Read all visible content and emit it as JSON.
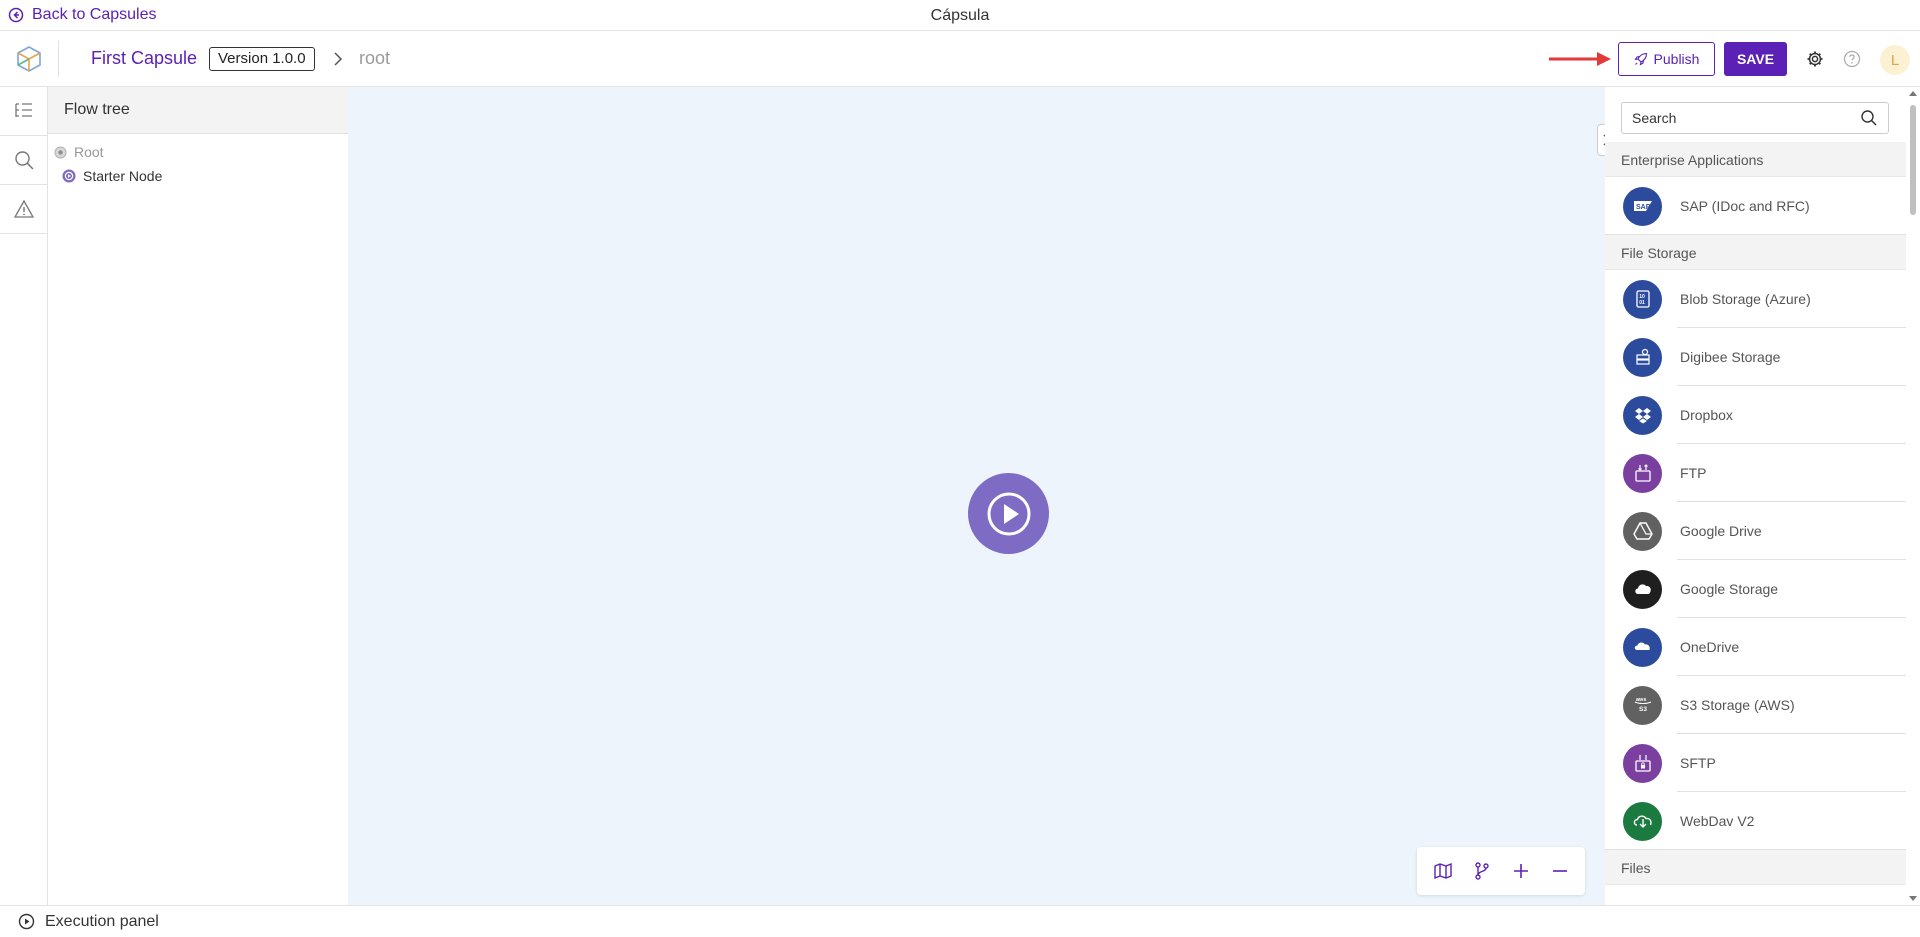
{
  "topbar": {
    "back_label": "Back to Capsules",
    "window_title": "Cápsula"
  },
  "header": {
    "capsule_name": "First Capsule",
    "version": "Version 1.0.0",
    "crumb": "root",
    "publish_label": "Publish",
    "save_label": "SAVE",
    "avatar_initial": "L"
  },
  "colors": {
    "accent": "#5b21b6",
    "node": "#7e6bc4",
    "canvas": "#eef4fc"
  },
  "flow_tree": {
    "title": "Flow tree",
    "root_label": "Root",
    "starter_label": "Starter Node"
  },
  "search": {
    "placeholder": "Search"
  },
  "groups": [
    {
      "title": "Enterprise Applications",
      "items": [
        {
          "label": "SAP (IDoc and RFC)",
          "icon": "sap-icon",
          "color": "#2d4b9c"
        }
      ]
    },
    {
      "title": "File Storage",
      "items": [
        {
          "label": "Blob Storage (Azure)",
          "icon": "blob-storage-icon",
          "color": "#2d4b9c"
        },
        {
          "label": "Digibee Storage",
          "icon": "digibee-storage-icon",
          "color": "#2d4b9c"
        },
        {
          "label": "Dropbox",
          "icon": "dropbox-icon",
          "color": "#2d4b9c"
        },
        {
          "label": "FTP",
          "icon": "ftp-icon",
          "color": "#7b3fa0"
        },
        {
          "label": "Google Drive",
          "icon": "google-drive-icon",
          "color": "#616161"
        },
        {
          "label": "Google Storage",
          "icon": "google-storage-icon",
          "color": "#1f1f1f"
        },
        {
          "label": "OneDrive",
          "icon": "onedrive-icon",
          "color": "#2d4b9c"
        },
        {
          "label": "S3 Storage (AWS)",
          "icon": "s3-icon",
          "color": "#616161"
        },
        {
          "label": "SFTP",
          "icon": "sftp-icon",
          "color": "#7b3fa0"
        },
        {
          "label": "WebDav V2",
          "icon": "webdav-icon",
          "color": "#1b7a3f"
        }
      ]
    },
    {
      "title": "Files",
      "items": []
    }
  ],
  "execution_panel": {
    "label": "Execution panel"
  }
}
